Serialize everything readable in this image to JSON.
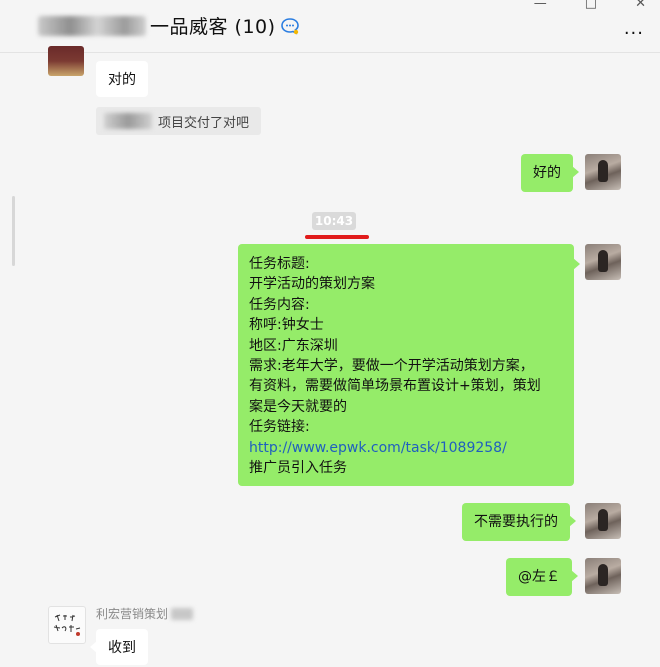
{
  "header": {
    "title": "一品威客 (10)",
    "more_label": "...",
    "window_controls": [
      "—",
      "□",
      "✕"
    ]
  },
  "messages": {
    "left_reply_1": "对的",
    "quote_text": "项目交付了对吧",
    "right_reply_1": "好的",
    "timestamp": "10:43",
    "task": {
      "lines": [
        "任务标题:",
        "开学活动的策划方案",
        "任务内容:",
        "称呼:钟女士",
        "地区:广东深圳",
        "需求:老年大学，要做一个开学活动策划方案，",
        "有资料，需要做简单场景布置设计+策划，策划",
        "案是今天就要的",
        "任务链接:"
      ],
      "link": "http://www.epwk.com/task/1089258/",
      "footer": "推广员引入任务"
    },
    "right_reply_2": "不需要执行的",
    "right_reply_3": "@左￡",
    "sender_name": "利宏营销策划",
    "left_reply_2": "收到"
  },
  "colors": {
    "background": "#f5f5f5",
    "bubble_green": "#95ec69",
    "bubble_white": "#ffffff",
    "link": "#1f5fbf",
    "time_underline": "#e11b1b"
  }
}
